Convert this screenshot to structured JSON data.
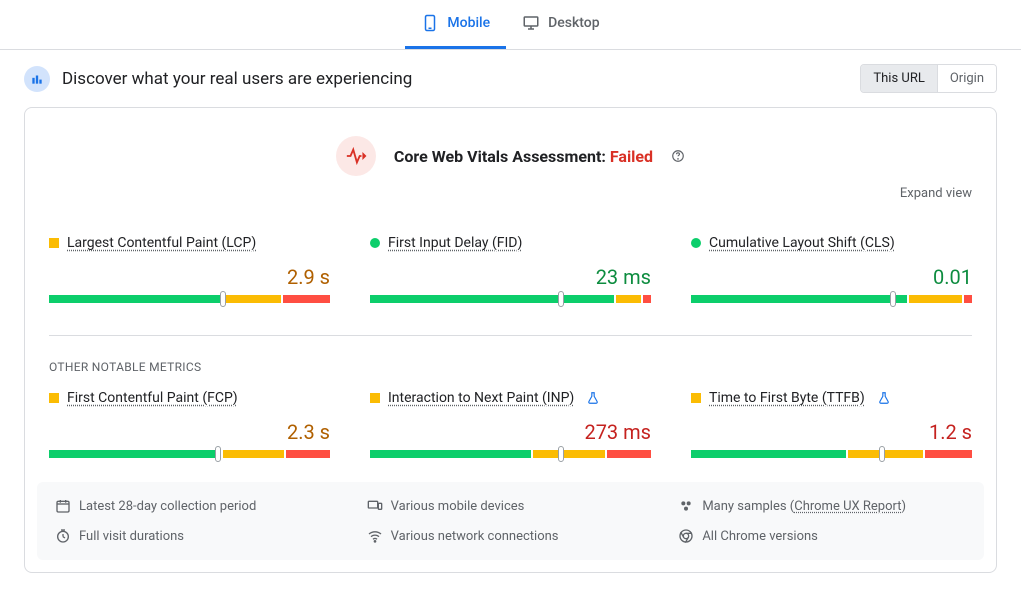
{
  "tabs": {
    "mobile": "Mobile",
    "desktop": "Desktop"
  },
  "banner": {
    "title": "Discover what your real users are experiencing"
  },
  "toggle": {
    "this_url": "This URL",
    "origin": "Origin"
  },
  "assessment": {
    "prefix": "Core Web Vitals Assessment: ",
    "status": "Failed"
  },
  "expand": "Expand view",
  "metrics": {
    "lcp": {
      "name": "Largest Contentful Paint (LCP)",
      "value": "2.9 s"
    },
    "fid": {
      "name": "First Input Delay (FID)",
      "value": "23 ms"
    },
    "cls": {
      "name": "Cumulative Layout Shift (CLS)",
      "value": "0.01"
    },
    "fcp": {
      "name": "First Contentful Paint (FCP)",
      "value": "2.3 s"
    },
    "inp": {
      "name": "Interaction to Next Paint (INP)",
      "value": "273 ms"
    },
    "ttfb": {
      "name": "Time to First Byte (TTFB)",
      "value": "1.2 s"
    }
  },
  "other_header": "OTHER NOTABLE METRICS",
  "footer": {
    "period": "Latest 28-day collection period",
    "devices": "Various mobile devices",
    "samples_prefix": "Many samples (",
    "samples_link": "Chrome UX Report",
    "samples_suffix": ")",
    "durations": "Full visit durations",
    "network": "Various network connections",
    "versions": "All Chrome versions"
  },
  "chart_data": [
    {
      "metric": "LCP",
      "type": "bar",
      "segments": {
        "good": 62,
        "needs_improvement": 21,
        "poor": 17
      },
      "marker_pct": 62,
      "value": "2.9 s",
      "status": "orange"
    },
    {
      "metric": "FID",
      "type": "bar",
      "segments": {
        "good": 88,
        "needs_improvement": 9,
        "poor": 3
      },
      "marker_pct": 68,
      "value": "23 ms",
      "status": "green"
    },
    {
      "metric": "CLS",
      "type": "bar",
      "segments": {
        "good": 78,
        "needs_improvement": 19,
        "poor": 3
      },
      "marker_pct": 72,
      "value": "0.01",
      "status": "green"
    },
    {
      "metric": "FCP",
      "type": "bar",
      "segments": {
        "good": 62,
        "needs_improvement": 22,
        "poor": 16
      },
      "marker_pct": 60,
      "value": "2.3 s",
      "status": "orange"
    },
    {
      "metric": "INP",
      "type": "bar",
      "segments": {
        "good": 58,
        "needs_improvement": 26,
        "poor": 16
      },
      "marker_pct": 68,
      "value": "273 ms",
      "status": "orange"
    },
    {
      "metric": "TTFB",
      "type": "bar",
      "segments": {
        "good": 56,
        "needs_improvement": 27,
        "poor": 17
      },
      "marker_pct": 68,
      "value": "1.2 s",
      "status": "orange"
    }
  ]
}
